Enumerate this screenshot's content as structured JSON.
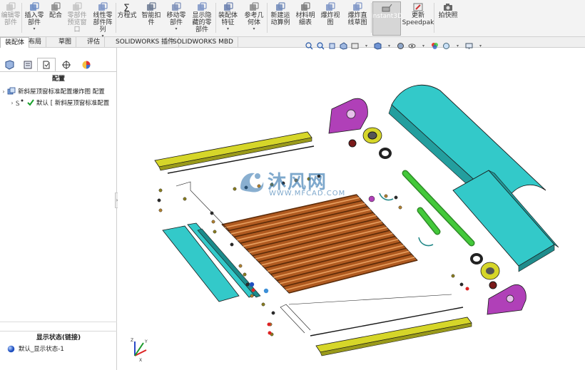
{
  "ribbon": {
    "buttons": [
      {
        "label": "编辑零\n部件",
        "icon": "edit-component-icon",
        "disabled": true,
        "dropdown": false
      },
      {
        "label": "插入零\n部件",
        "icon": "insert-component-icon",
        "disabled": false,
        "dropdown": true
      },
      {
        "label": "配合",
        "icon": "mate-icon",
        "disabled": false,
        "dropdown": false
      },
      {
        "label": "零部件\n预览窗\n口",
        "icon": "component-preview-icon",
        "disabled": true,
        "dropdown": false
      },
      {
        "label": "线性零\n部件阵\n列",
        "icon": "linear-pattern-icon",
        "disabled": false,
        "dropdown": true
      },
      {
        "label": "方程式",
        "icon": "equation-icon",
        "disabled": false,
        "dropdown": false
      },
      {
        "label": "智能扣\n件",
        "icon": "smart-fastener-icon",
        "disabled": false,
        "dropdown": false
      },
      {
        "label": "移动零\n部件",
        "icon": "move-component-icon",
        "disabled": false,
        "dropdown": true
      },
      {
        "label": "显示隐\n藏的零\n部件",
        "icon": "show-hidden-icon",
        "disabled": false,
        "dropdown": false
      },
      {
        "label": "装配体\n特征",
        "icon": "assembly-feature-icon",
        "disabled": false,
        "dropdown": true
      },
      {
        "label": "参考几\n何体",
        "icon": "reference-geometry-icon",
        "disabled": false,
        "dropdown": true
      },
      {
        "label": "新建运\n动算例",
        "icon": "motion-study-icon",
        "disabled": false,
        "dropdown": false
      },
      {
        "label": "材料明\n细表",
        "icon": "bom-icon",
        "disabled": false,
        "dropdown": false
      },
      {
        "label": "爆炸视\n图",
        "icon": "exploded-view-icon",
        "disabled": false,
        "dropdown": false
      },
      {
        "label": "爆炸直\n线草图",
        "icon": "explode-line-sketch-icon",
        "disabled": false,
        "dropdown": false
      },
      {
        "label": "Instant3D",
        "icon": "instant3d-icon",
        "disabled": false,
        "dropdown": false,
        "active": true
      },
      {
        "label": "更新\nSpeedpak",
        "icon": "speedpak-icon",
        "disabled": false,
        "dropdown": false
      },
      {
        "label": "拍快照",
        "icon": "snapshot-icon",
        "disabled": false,
        "dropdown": false
      }
    ]
  },
  "tabs": [
    {
      "label": "装配体",
      "active": true
    },
    {
      "label": "布局",
      "active": false
    },
    {
      "label": "草图",
      "active": false
    },
    {
      "label": "评估",
      "active": false
    },
    {
      "label": "SOLIDWORKS 插件",
      "active": false
    },
    {
      "label": "SOLIDWORKS MBD",
      "active": false
    }
  ],
  "panel": {
    "tabs": [
      {
        "icon": "feature-manager-icon"
      },
      {
        "icon": "property-manager-icon"
      },
      {
        "icon": "configuration-manager-icon",
        "active": true
      },
      {
        "icon": "dimxpert-icon"
      },
      {
        "icon": "display-manager-icon"
      }
    ],
    "config_header": "配置",
    "tree": {
      "root_label": "新斜屋顶窗标准配置爆炸图 配置",
      "child_label": "默认 [ 新斜屋顶窗标准配置"
    },
    "display_state_header": "显示状态(链接)",
    "display_state_item": "默认_显示状态-1"
  },
  "watermark": {
    "brand": "沐风网",
    "url": "WWW.MFCAD.COM"
  },
  "colors": {
    "yellow_part": "#d6d629",
    "cyan_part": "#33c9c9",
    "purple_part": "#b040b8",
    "green_part": "#43c93a",
    "orange_part": "#c46a2a",
    "active_tool": "#d6d6d6",
    "accent_blue": "#1f5fbf"
  }
}
